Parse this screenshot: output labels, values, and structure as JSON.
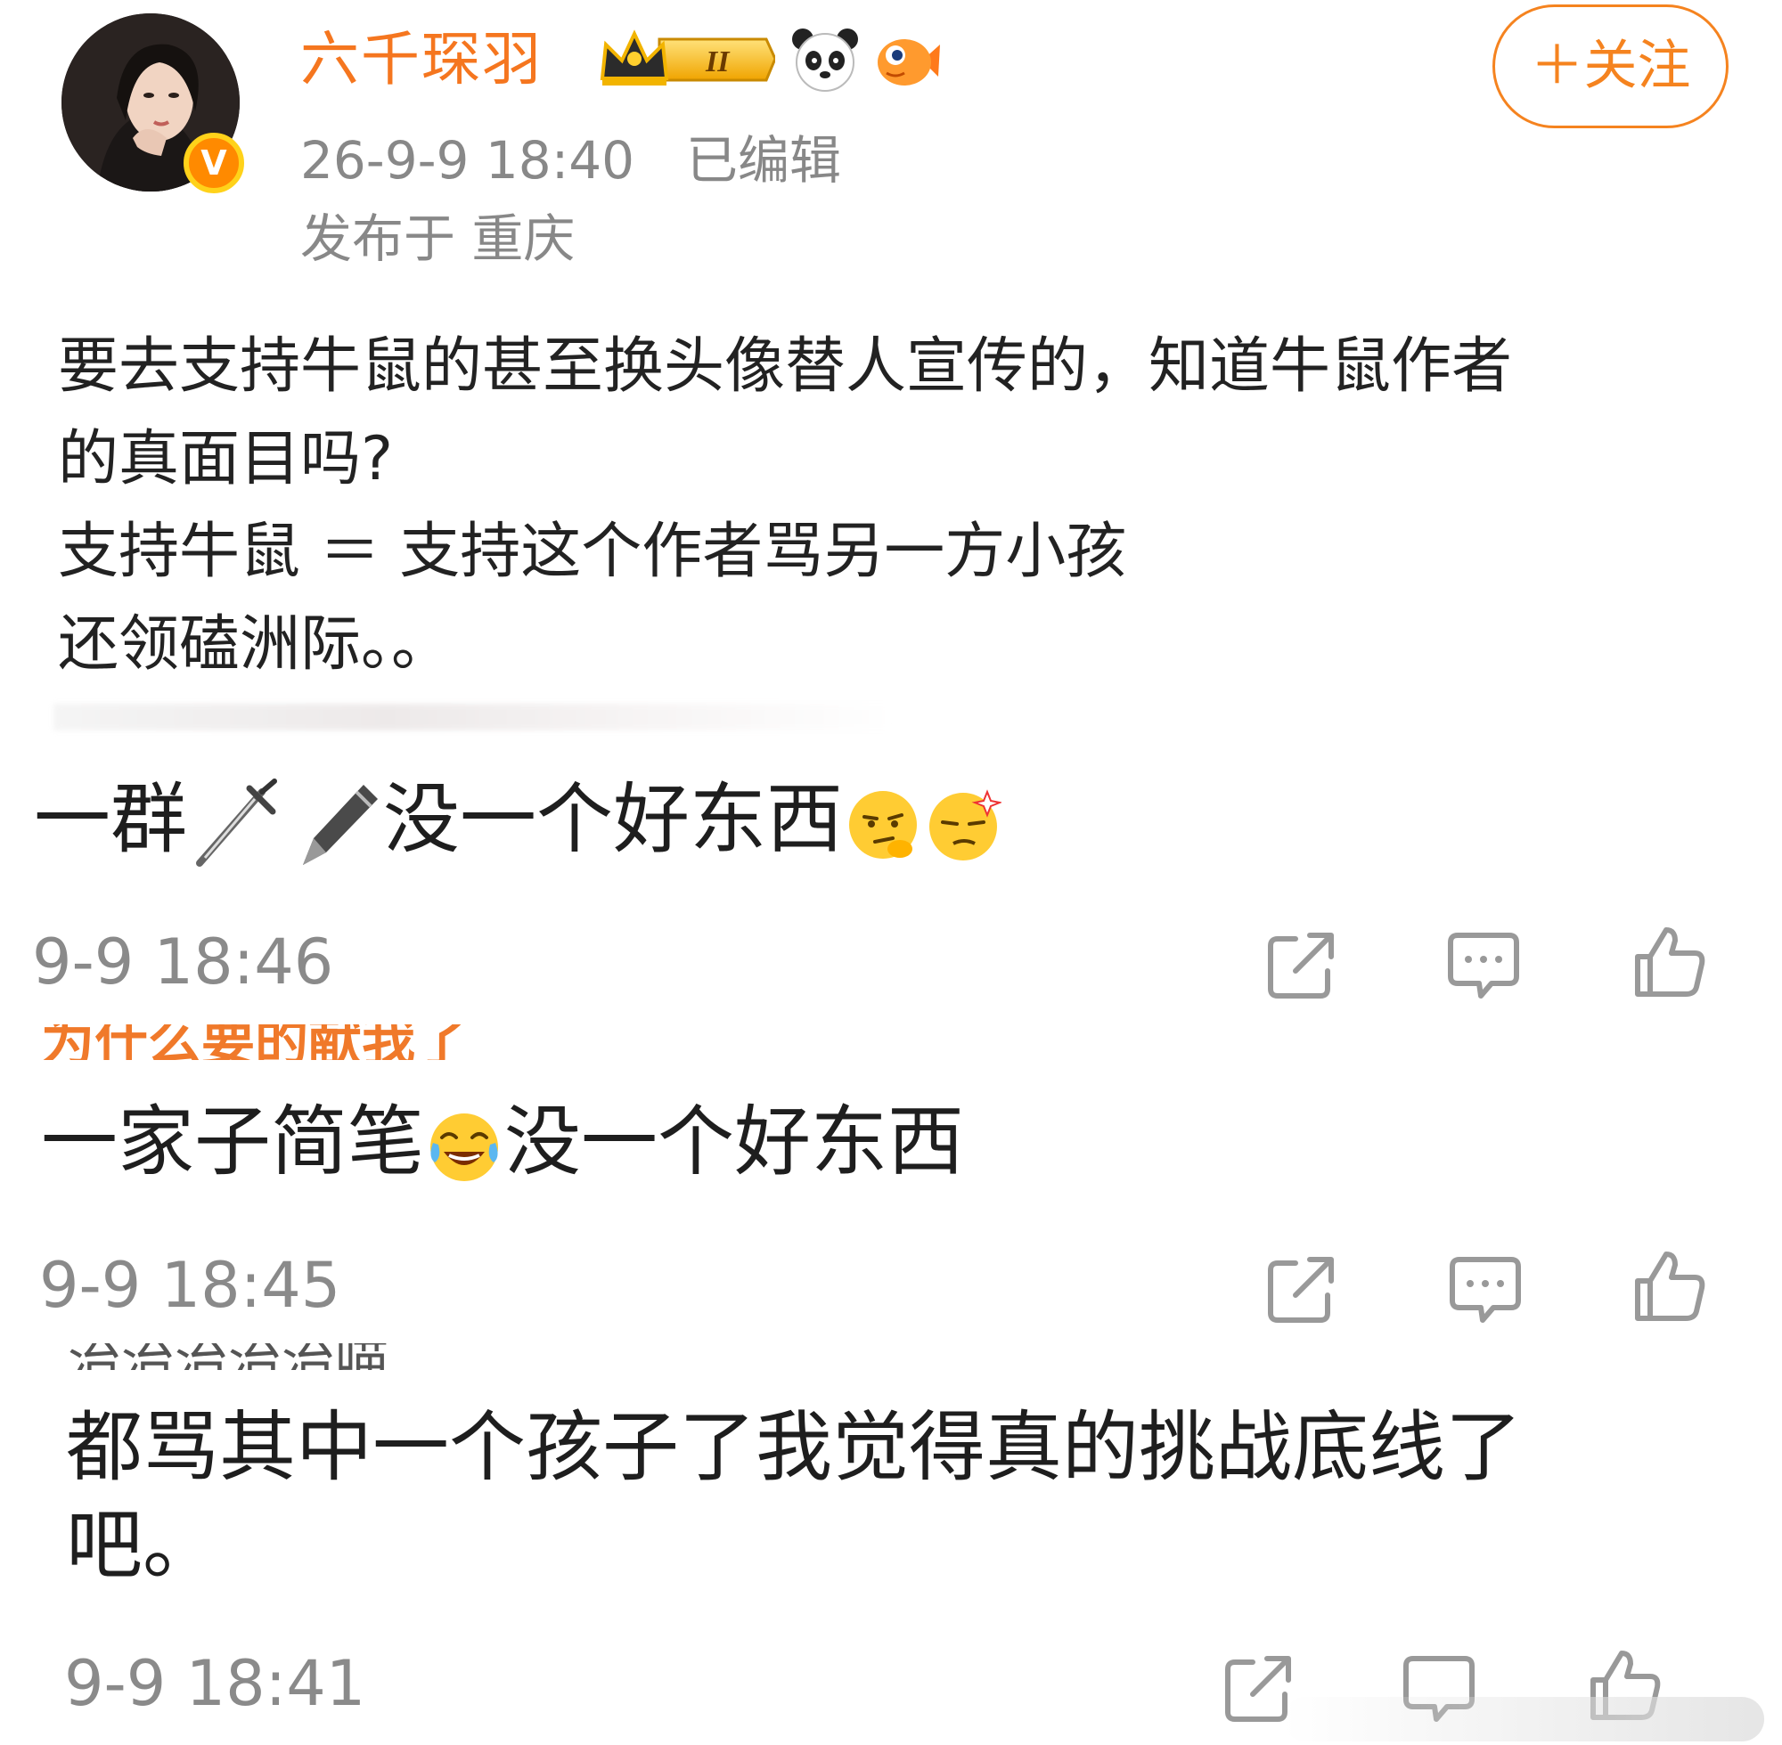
{
  "post": {
    "username": "六千琛羽",
    "follow_label": "＋关注",
    "time": "26-9-9 18:40",
    "edited": "已编辑",
    "location": "发布于 重庆",
    "body": "要去支持牛鼠的甚至换头像替人宣传的，知道牛鼠作者\n的真面目吗?\n支持牛鼠 ＝ 支持这个作者骂另一方小孩\n还领磕洲际。。",
    "badges": [
      "crown-level-badge",
      "panda-icon",
      "fish-icon"
    ],
    "verified_badge": "V"
  },
  "comments": [
    {
      "text_before": "一群",
      "text_after": "没一个好东西",
      "inline_icons": [
        "dagger-icon",
        "pen-icon"
      ],
      "emojis": [
        "thinking-emoji",
        "smug-emoji"
      ],
      "time": "9-9 18:46"
    },
    {
      "name_fragment": "为什么要的献我了",
      "text_before": "一家子简笔",
      "text_after": "没一个好东西",
      "emojis": [
        "laughing-tears-emoji"
      ],
      "time": "9-9 18:45"
    },
    {
      "name_fragment": "治治治治治喵_",
      "text": "都骂其中一个孩子了我觉得真的挑战底线了\n吧。",
      "time": "9-9 18:41"
    }
  ],
  "colors": {
    "accent_orange": "#f5761f",
    "meta_grey": "#888888",
    "text": "#1e1e1e"
  }
}
